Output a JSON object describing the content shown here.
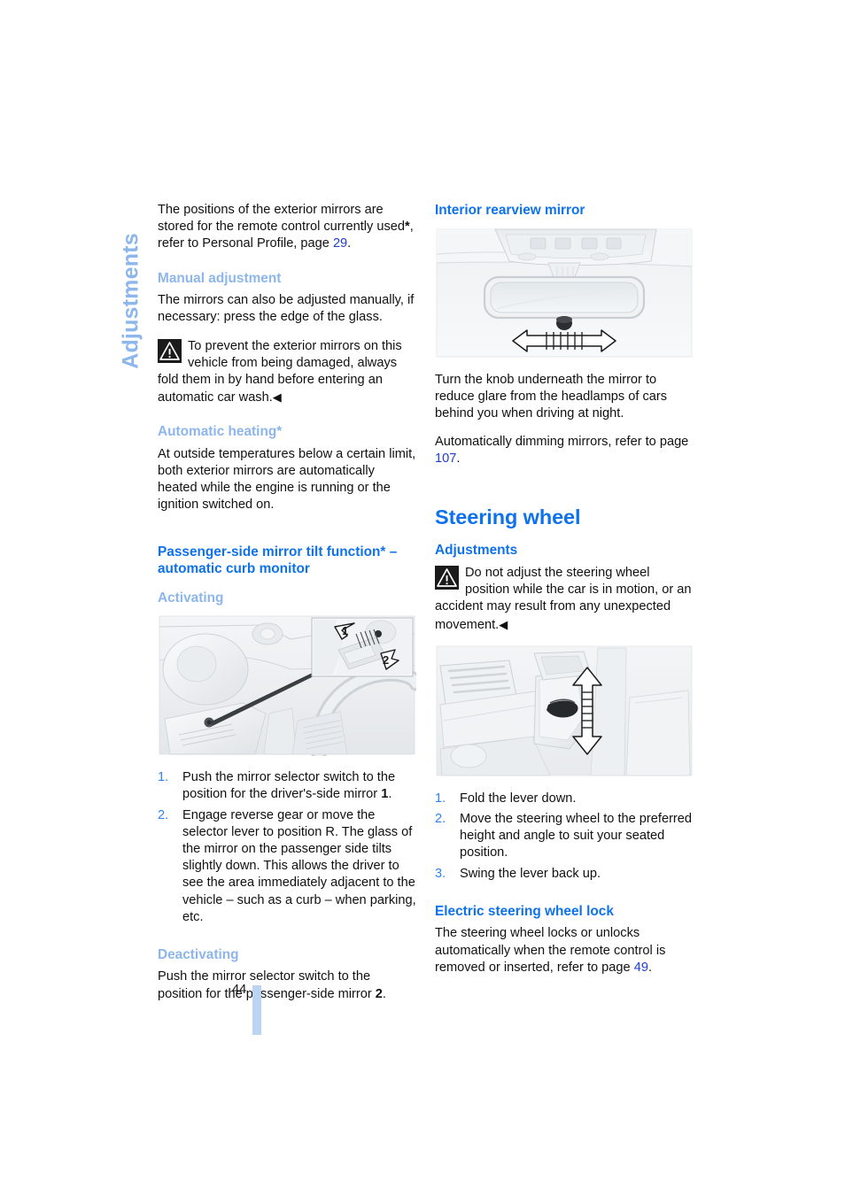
{
  "page": {
    "number": "44",
    "side_tab": "Adjustments"
  },
  "left_column": {
    "intro": {
      "text_before": "The positions of the exterior mirrors are stored for the remote control currently used",
      "asterisk": "*",
      "text_middle": ", refer to Personal Profile, page ",
      "page_ref": "29",
      "text_after": "."
    },
    "manual_adjustment": {
      "heading": "Manual adjustment",
      "body": "The mirrors can also be adjusted manually, if necessary: press the edge of the glass.",
      "warning": "To prevent the exterior mirrors on this vehicle from being damaged, always fold them in by hand before entering an automatic car wash.",
      "warning_end_marker": "◀"
    },
    "automatic_heating": {
      "heading": "Automatic heating*",
      "body": "At outside temperatures below a certain limit, both exterior mirrors are automatically heated while the engine is running or the ignition switched on."
    },
    "tilt_function": {
      "heading_line1": "Passenger-side mirror tilt function* –",
      "heading_line2": "automatic curb monitor",
      "activating_heading": "Activating",
      "figure_alt": "Door panel with mirror selector switch and inset detail showing positions 1 and 2",
      "figure_labels": [
        "1",
        "2"
      ],
      "steps": [
        {
          "num": "1.",
          "text_a": "Push the mirror selector switch to the position for the driver's-side mirror ",
          "bold": "1",
          "text_b": "."
        },
        {
          "num": "2.",
          "text_a": "Engage reverse gear or move the selector lever to position R. The glass of the mirror on the passenger side tilts slightly down. This allows the driver to see the area immediately adjacent to the vehicle – such as a curb – when parking, etc.",
          "bold": "",
          "text_b": ""
        }
      ],
      "deactivating_heading": "Deactivating",
      "deactivating_body_a": "Push the mirror selector switch to the position for the passenger-side mirror ",
      "deactivating_bold": "2",
      "deactivating_body_b": "."
    }
  },
  "right_column": {
    "interior_mirror": {
      "heading": "Interior rearview mirror",
      "figure_alt": "Interior rearview mirror with overhead console, dimming knob and double arrow",
      "body1": "Turn the knob underneath the mirror to reduce glare from the headlamps of cars behind you when driving at night.",
      "body2_a": "Automatically dimming mirrors, refer to page ",
      "body2_ref": "107",
      "body2_b": "."
    },
    "steering_wheel": {
      "chapter_title": "Steering wheel",
      "adjustments_heading": "Adjustments",
      "warning": "Do not adjust the steering wheel position while the car is in motion, or an accident may result from any unexpected movement.",
      "warning_end_marker": "◀",
      "figure_alt": "Steering column with release lever and vertical double arrow showing adjustment range",
      "steps": [
        {
          "num": "1.",
          "text": "Fold the lever down."
        },
        {
          "num": "2.",
          "text": "Move the steering wheel to the preferred height and angle to suit your seated position."
        },
        {
          "num": "3.",
          "text": "Swing the lever back up."
        }
      ],
      "lock_heading": "Electric steering wheel lock",
      "lock_body_a": "The steering wheel locks or unlocks automatically when the remote control is removed or inserted, refer to page ",
      "lock_body_ref": "49",
      "lock_body_b": "."
    }
  },
  "colors": {
    "heading_blue": "#0E72EE",
    "subheading_blue": "#8CB6EC",
    "page_ref_blue": "#1F3FD6",
    "number_blue": "#2F82F0",
    "page_bar": "#BBD4F4"
  }
}
